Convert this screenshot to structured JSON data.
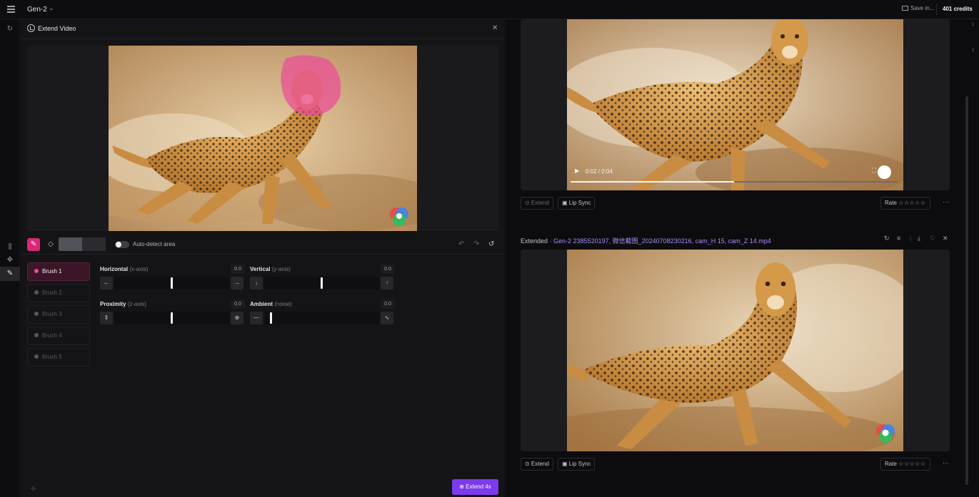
{
  "topbar": {
    "model": "Gen-2",
    "chevron": "⌄",
    "save_label": "Save in...",
    "credits": "401 credits"
  },
  "panel": {
    "title": "Extend Video",
    "close": "✕",
    "auto_detect_label": "Auto-detect area",
    "extend_button": "⊕ Extend 4s"
  },
  "brushes": [
    {
      "label": "Brush 1",
      "active": true
    },
    {
      "label": "Brush 2",
      "active": false
    },
    {
      "label": "Brush 3",
      "active": false
    },
    {
      "label": "Brush 4",
      "active": false
    },
    {
      "label": "Brush 5",
      "active": false
    }
  ],
  "controls": {
    "horizontal": {
      "name": "Horizontal",
      "axis": "(x-axis)",
      "value": "0.0",
      "left": "←",
      "right": "→",
      "level": 0.5
    },
    "vertical": {
      "name": "Vertical",
      "axis": "(y-axis)",
      "value": "0.0",
      "left": "↓",
      "right": "↑",
      "level": 0.5
    },
    "proximity": {
      "name": "Proximity",
      "axis": "(z-axis)",
      "value": "0.0",
      "left": "⇕",
      "right": "⊕",
      "level": 0.5
    },
    "ambient": {
      "name": "Ambient",
      "axis": "(noise)",
      "value": "0.0",
      "left": "—",
      "right": "∿",
      "level": 0.05
    }
  },
  "result1": {
    "time": "0:02 / 0:04",
    "progress": 0.5,
    "extend_label": "⊙ Extend",
    "lipsync_label": "▣ Lip Sync",
    "rate_label": "Rate",
    "stars": "☆☆☆☆☆",
    "more": "···"
  },
  "result2": {
    "prefix": "Extended · ",
    "filename": "Gen-2 2385520197, 微信截图_20240708230216, cam_H 15, cam_Z 14.mp4",
    "extend_label": "⊙ Extend",
    "lipsync_label": "▣ Lip Sync",
    "rate_label": "Rate",
    "stars": "☆☆☆☆☆",
    "more": "···"
  },
  "side_numbers": [
    "1",
    "2"
  ],
  "colors": {
    "accent_pink": "#db2777",
    "accent_purple": "#7c3aed",
    "filename_purple": "#a78bfa"
  }
}
